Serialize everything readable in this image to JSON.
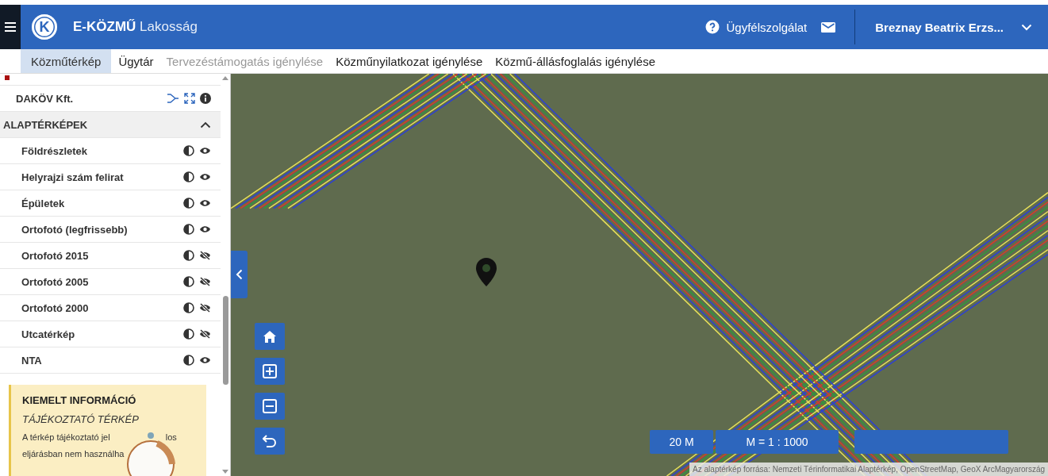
{
  "header": {
    "logo_letter": "K",
    "brand": "E-KÖZMŰ",
    "brand_suffix": "Lakosság",
    "support": "Ügyfélszolgálat",
    "user": "Breznay Beatrix Erzs..."
  },
  "tabs": [
    {
      "label": "Közműtérkép",
      "selected": true,
      "disabled": false
    },
    {
      "label": "Ügytár",
      "selected": false,
      "disabled": false
    },
    {
      "label": "Tervezéstámogatás igénylése",
      "selected": false,
      "disabled": true
    },
    {
      "label": "Közműnyilatkozat igénylése",
      "selected": false,
      "disabled": false
    },
    {
      "label": "Közmű-állásfoglalás igénylése",
      "selected": false,
      "disabled": false
    }
  ],
  "sidebar": {
    "provider": "DAKÖV Kft.",
    "section": {
      "title": "ALAPTÉRKÉPEK",
      "expanded": true,
      "layers": [
        {
          "name": "Földrészletek",
          "visible": true
        },
        {
          "name": "Helyrajzi szám felirat",
          "visible": true
        },
        {
          "name": "Épületek",
          "visible": true
        },
        {
          "name": "Ortofotó (legfrissebb)",
          "visible": true
        },
        {
          "name": "Ortofotó 2015",
          "visible": false
        },
        {
          "name": "Ortofotó 2005",
          "visible": false
        },
        {
          "name": "Ortofotó 2000",
          "visible": false
        },
        {
          "name": "Utcatérkép",
          "visible": false
        },
        {
          "name": "NTA",
          "visible": true
        }
      ]
    },
    "info": {
      "title": "KIEMELT INFORMÁCIÓ",
      "subtitle": "TÁJÉKOZTATÓ TÉRKÉP",
      "line_1_start": "A térkép tájékoztató jel",
      "line_1_end": "los",
      "line_2": "eljárásban nem használha"
    }
  },
  "map": {
    "scale": "20 M",
    "ratio": "M = 1 : 1000",
    "attribution": "Az alaptérkép forrása: Nemzeti Térinformatikai Alaptérkép, OpenStreetMap, GeoX ArcMagyarország"
  }
}
